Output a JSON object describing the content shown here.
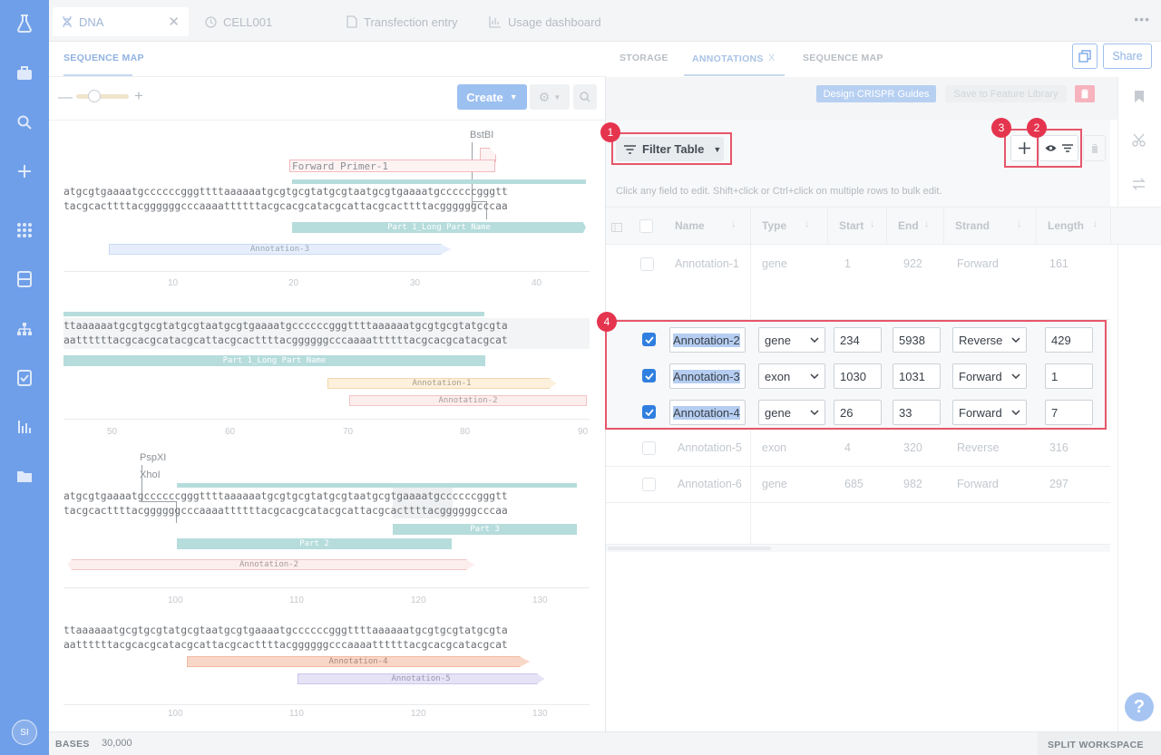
{
  "nav": {
    "avatar": "SI"
  },
  "tabs": [
    {
      "label": "DNA"
    },
    {
      "label": "CELL001"
    },
    {
      "label": "Transfection entry"
    },
    {
      "label": "Usage dashboard"
    }
  ],
  "left": {
    "title": "SEQUENCE MAP",
    "create_label": "Create",
    "rows": [
      {
        "top": "atgcgtgaaaatgccccccgggttttaaaaaatgcgtgcgtatgcgtaatgcgtgaaaatgccccccgggtt",
        "bottom": "tacgcacttttacggggggcccaaaattttttacgcacgcatacgcattacgcacttttacggggggcccaa",
        "ticks": [
          "10",
          "20",
          "30",
          "40"
        ]
      },
      {
        "top": "ttaaaaaatgcgtgcgtatgcgtaatgcgtgaaaatgccccccgggttttaaaaaatgcgtgcgtatgcgta",
        "bottom": "aattttttacgcacgcatacgcattacgcacttttacggggggcccaaaattttttacgcacgcatacgcat",
        "ticks": [
          "50",
          "60",
          "70",
          "80",
          "90"
        ]
      },
      {
        "top": "atgcgtgaaaatgccccccgggttttaaaaaatgcgtgcgtatgcgtaatgcgtgaaaatgccccccgggtt",
        "bottom": "tacgcacttttacggggggcccaaaattttttacgcacgcatacgcattacgcacttttacggggggcccaa",
        "ticks": [
          "100",
          "110",
          "120",
          "130"
        ]
      },
      {
        "top": "ttaaaaaatgcgtgcgtatgcgtaatgcgtgaaaatgccccccgggttttaaaaaatgcgtgcgtatgcgta",
        "bottom": "aattttttacgcacgcatacgcattacgcacttttacggggggcccaaaattttttacgcacgcatacgcat",
        "ticks": [
          "100",
          "110",
          "120",
          "130"
        ]
      }
    ],
    "features": {
      "bstbi": "BstBI",
      "primer": "Forward Primer-1",
      "part1": "Part 1_Long Part Name",
      "ann3": "Annotation-3",
      "ann1": "Annotation-1",
      "ann2": "Annotation-2",
      "pspxi": "PspXI",
      "xhoi": "XhoI",
      "part3": "Part 3",
      "part2": "Part 2",
      "ann4": "Annotation-4",
      "ann5": "Annotation-5"
    },
    "footer_label": "BASES",
    "footer_value": "30,000"
  },
  "right": {
    "tabs": [
      "STORAGE",
      "ANNOTATIONS",
      "SEQUENCE MAP"
    ],
    "tab_close": "X",
    "copy_icon": "copy-icon",
    "share_label": "Share",
    "design_crispr": "Design CRISPR Guides",
    "save_feature": "Save to Feature Library",
    "filter_label": "Filter Table",
    "hint": "Click any field to edit. Shift+click or Ctrl+click on multiple rows to bulk edit.",
    "columns": [
      "Name",
      "Type",
      "Start",
      "End",
      "Strand",
      "Length"
    ],
    "rows": [
      {
        "name": "Annotation-1",
        "type": "gene",
        "start": "1",
        "end": "922",
        "strand": "Forward",
        "length": "161",
        "selected": false
      },
      {
        "name": "Annotation-2",
        "type": "gene",
        "start": "234",
        "end": "5938",
        "strand": "Reverse",
        "length": "429",
        "selected": true
      },
      {
        "name": "Annotation-3",
        "type": "exon",
        "start": "1030",
        "end": "1031",
        "strand": "Forward",
        "length": "1",
        "selected": true
      },
      {
        "name": "Annotation-4",
        "type": "gene",
        "start": "26",
        "end": "33",
        "strand": "Forward",
        "length": "7",
        "selected": true
      },
      {
        "name": "Annotation-5",
        "type": "exon",
        "start": "4",
        "end": "320",
        "strand": "Reverse",
        "length": "316",
        "selected": false
      },
      {
        "name": "Annotation-6",
        "type": "gene",
        "start": "685",
        "end": "982",
        "strand": "Forward",
        "length": "297",
        "selected": false
      }
    ],
    "badges": [
      "1",
      "2",
      "3",
      "4"
    ],
    "footer": "SPLIT WORKSPACE",
    "help": "?"
  },
  "colors": {
    "nav": "#6f9fe8",
    "accent": "#2f7fe0",
    "highlight": "#e5344e",
    "part": "#b6dcdc"
  }
}
